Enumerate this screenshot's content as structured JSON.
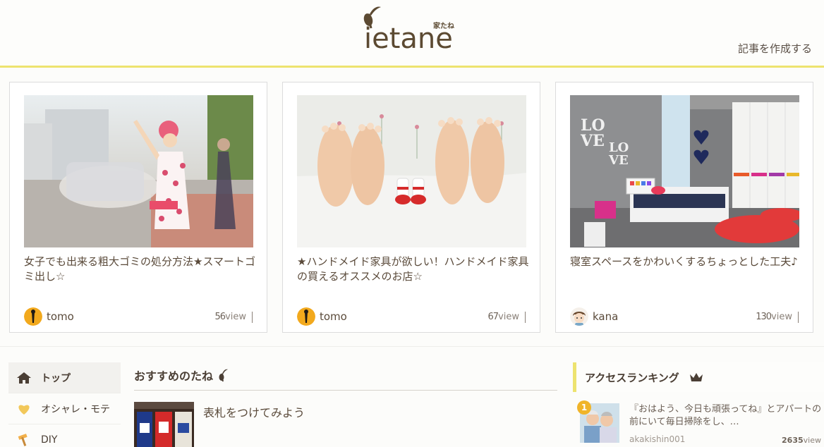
{
  "header": {
    "logo_word": "ietane",
    "logo_kana": "家たね",
    "create_link": "記事を作成する"
  },
  "cards": [
    {
      "title": "女子でも出来る粗大ゴミの処分方法★スマートゴミ出し☆",
      "author": "tomo",
      "views": "56",
      "views_unit": "view"
    },
    {
      "title": "★ハンドメイド家具が欲しい！ハンドメイド家具の買えるオススメのお店☆",
      "author": "tomo",
      "views": "67",
      "views_unit": "view"
    },
    {
      "title": "寝室スペースをかわいくするちょっとした工夫♪",
      "author": "kana",
      "views": "130",
      "views_unit": "view"
    }
  ],
  "nav": {
    "items": [
      {
        "label": "トップ",
        "icon": "home-icon"
      },
      {
        "label": "オシャレ・モテ",
        "icon": "heart-icon"
      },
      {
        "label": "DIY",
        "icon": "hammer-icon"
      }
    ]
  },
  "reco": {
    "heading": "おすすめのたね",
    "item_title": "表札をつけてみよう"
  },
  "ranking": {
    "heading": "アクセスランキング",
    "rank": "1",
    "text": "『おはよう、今日も頑張ってね』とアパートの前にいて毎日掃除をし、…",
    "user": "akakishin001",
    "views": "2635",
    "views_unit": "view"
  },
  "colors": {
    "accent": "#ede36f",
    "brand": "#5c4a32",
    "badge": "#f0b429"
  }
}
